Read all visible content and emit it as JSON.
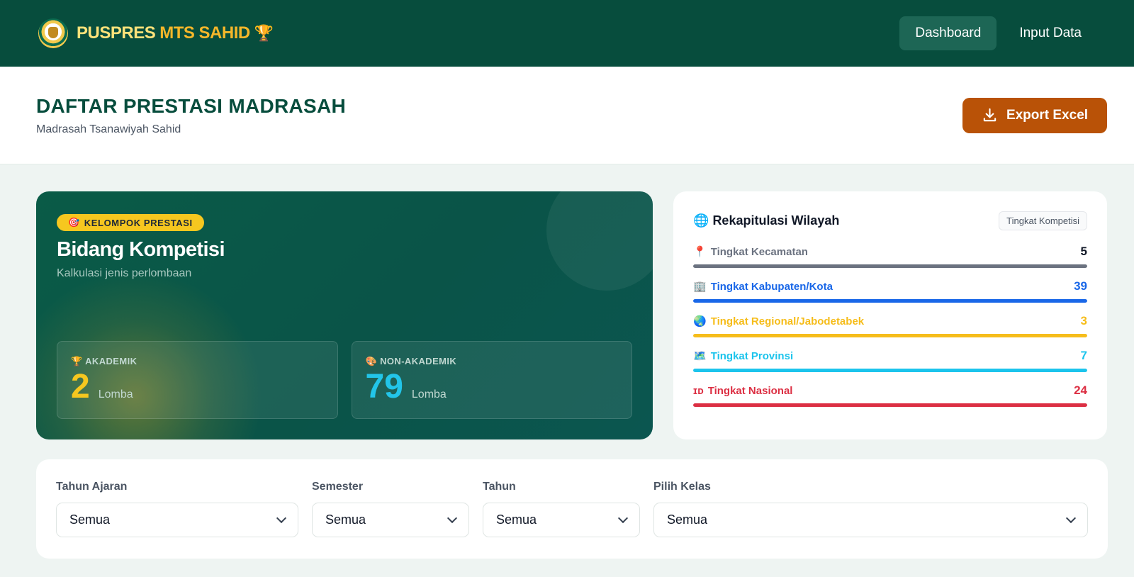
{
  "navbar": {
    "brand_part1": "PUSPRES",
    "brand_part2": "MTS SAHID",
    "brand_emoji": "🏆",
    "links": [
      "Dashboard",
      "Input Data"
    ]
  },
  "header": {
    "title": "DAFTAR PRESTASI MADRASAH",
    "subtitle": "Madrasah Tsanawiyah Sahid",
    "export_label": "Export Excel"
  },
  "competition": {
    "badge_emoji": "🎯",
    "badge": "KELOMPOK PRESTASI",
    "title": "Bidang Kompetisi",
    "subtitle": "Kalkulasi jenis perlombaan",
    "stats": [
      {
        "emoji": "🏆",
        "label": "AKADEMIK",
        "value": "2",
        "unit": "Lomba",
        "color": "#f6c71f"
      },
      {
        "emoji": "🎨",
        "label": "NON-AKADEMIK",
        "value": "79",
        "unit": "Lomba",
        "color": "#22c5e9"
      }
    ]
  },
  "recap": {
    "emoji": "🌐",
    "title": "Rekapitulasi Wilayah",
    "tag": "Tingkat Kompetisi",
    "items": [
      {
        "emoji": "📍",
        "label": "Tingkat Kecamatan",
        "value": "5",
        "color": "#6b7280",
        "value_color": "#111827"
      },
      {
        "emoji": "🏢",
        "label": "Tingkat Kabupaten/Kota",
        "value": "39",
        "color": "#1967e8",
        "value_color": "#1967e8"
      },
      {
        "emoji": "🌏",
        "label": "Tingkat Regional/Jabodetabek",
        "value": "3",
        "color": "#f6bd1b",
        "value_color": "#f6bd1b"
      },
      {
        "emoji": "🗺️",
        "label": "Tingkat Provinsi",
        "value": "7",
        "color": "#1cc4ec",
        "value_color": "#1cc4ec"
      },
      {
        "emoji": "ɪᴅ",
        "label": "Tingkat Nasional",
        "value": "24",
        "color": "#dc2f43",
        "value_color": "#dc2f43"
      }
    ]
  },
  "filters": [
    {
      "label": "Tahun Ajaran",
      "value": "Semua"
    },
    {
      "label": "Semester",
      "value": "Semua"
    },
    {
      "label": "Tahun",
      "value": "Semua"
    },
    {
      "label": "Pilih Kelas",
      "value": "Semua"
    }
  ]
}
